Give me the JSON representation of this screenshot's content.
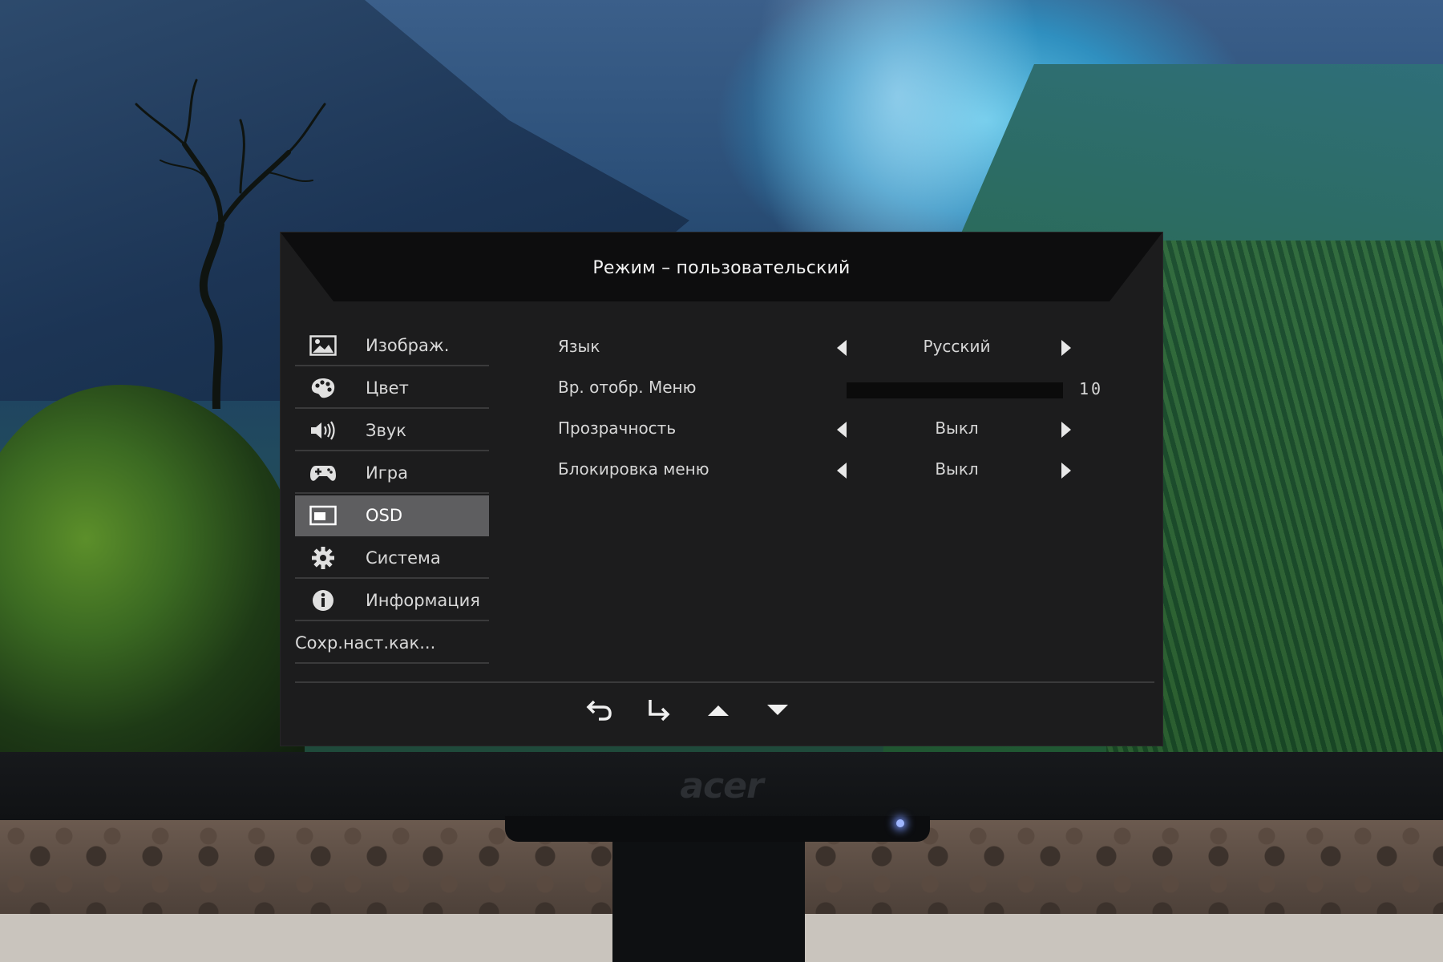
{
  "osd": {
    "title": "Режим – пользовательский",
    "menu": [
      {
        "label": "Изображ.",
        "icon": "picture-icon",
        "active": false
      },
      {
        "label": "Цвет",
        "icon": "palette-icon",
        "active": false
      },
      {
        "label": "Звук",
        "icon": "speaker-icon",
        "active": false
      },
      {
        "label": "Игра",
        "icon": "gamepad-icon",
        "active": false
      },
      {
        "label": "OSD",
        "icon": "osd-window-icon",
        "active": true
      },
      {
        "label": "Система",
        "icon": "gear-icon",
        "active": false
      },
      {
        "label": "Информация",
        "icon": "info-icon",
        "active": false
      },
      {
        "label": "Сохр.наст.как...",
        "icon": "",
        "active": false
      }
    ],
    "settings": [
      {
        "name": "Язык",
        "type": "select",
        "value": "Русский"
      },
      {
        "name": "Вр. отобр. Меню",
        "type": "slider",
        "value": "10"
      },
      {
        "name": "Прозрачность",
        "type": "select",
        "value": "Выкл"
      },
      {
        "name": "Блокировка меню",
        "type": "select",
        "value": "Выкл"
      }
    ],
    "nav_buttons": [
      {
        "icon": "back-arrow-icon"
      },
      {
        "icon": "enter-arrow-icon"
      },
      {
        "icon": "up-triangle-icon"
      },
      {
        "icon": "down-triangle-icon"
      }
    ],
    "colors": {
      "panel": "#1c1c1d",
      "header": "#0d0d0e",
      "active_item": "#5e5e60",
      "text": "#d8d8d8"
    }
  },
  "monitor": {
    "brand_logo": "acer"
  }
}
